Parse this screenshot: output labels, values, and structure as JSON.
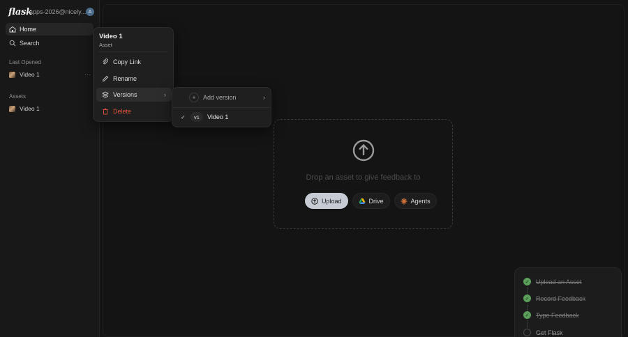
{
  "app": {
    "logo": "flask",
    "account": "apps-2026@nicely...",
    "avatar_initial": "A"
  },
  "sidebar": {
    "nav": [
      {
        "label": "Home",
        "icon": "home-icon"
      },
      {
        "label": "Search",
        "icon": "search-icon"
      }
    ],
    "last_opened_label": "Last Opened",
    "last_opened": [
      {
        "label": "Video 1"
      }
    ],
    "assets_label": "Assets",
    "assets": [
      {
        "label": "Video 1"
      }
    ],
    "more_label": "···"
  },
  "context_menu": {
    "title": "Video 1",
    "subtitle": "Asset",
    "items": [
      {
        "label": "Copy Link",
        "icon": "link-icon"
      },
      {
        "label": "Rename",
        "icon": "pencil-icon"
      },
      {
        "label": "Versions",
        "icon": "layers-icon",
        "chevron": "›"
      },
      {
        "label": "Delete",
        "icon": "trash-icon"
      }
    ]
  },
  "versions_submenu": {
    "add_label": "Add version",
    "add_chevron": "›",
    "versions": [
      {
        "check": "✓",
        "badge": "v1",
        "label": "Video 1"
      }
    ]
  },
  "dropzone": {
    "text": "Drop an asset to give feedback to",
    "buttons": [
      {
        "label": "Upload"
      },
      {
        "label": "Drive"
      },
      {
        "label": "Agents"
      }
    ]
  },
  "checklist": {
    "steps": [
      {
        "label": "Upload an Asset",
        "done": true,
        "check": "✓"
      },
      {
        "label": "Record Feedback",
        "done": true,
        "check": "✓"
      },
      {
        "label": "Type Feedback",
        "done": true,
        "check": "✓"
      },
      {
        "label": "Get Flask",
        "done": false
      }
    ]
  },
  "colors": {
    "background": "#141414",
    "accent_upload": "#c7ccd4",
    "danger": "#e5533d",
    "done_green": "#5ba05a"
  }
}
